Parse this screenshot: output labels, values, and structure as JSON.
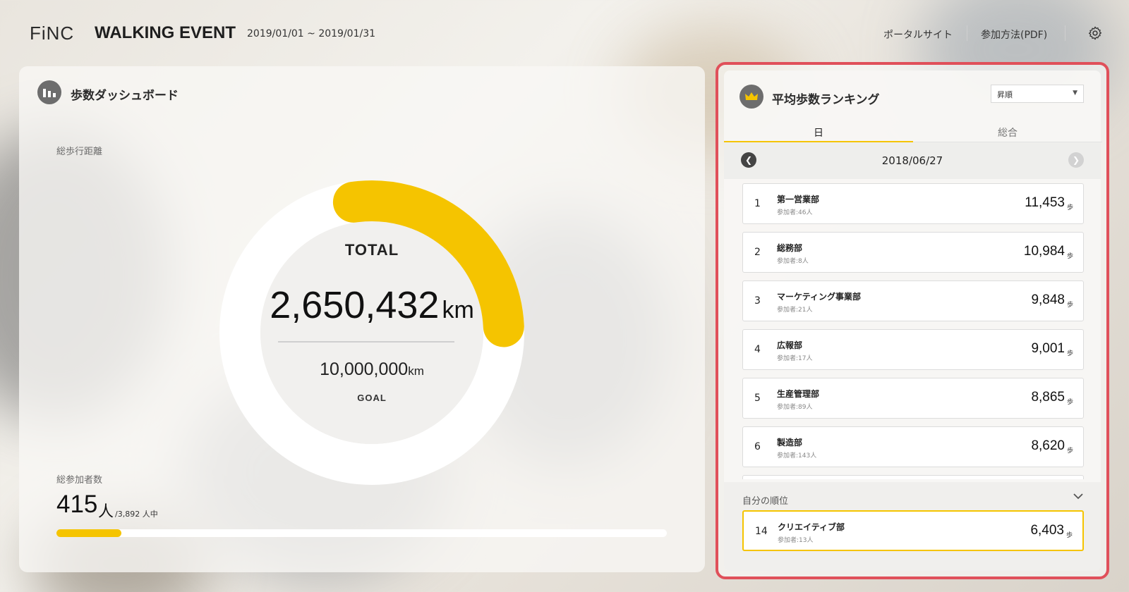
{
  "header": {
    "logo": "FiNC",
    "title": "WALKING EVENT",
    "dates": "2019/01/01 ~ 2019/01/31",
    "nav_portal": "ポータルサイト",
    "nav_pdf": "参加方法(PDF)"
  },
  "dashboard": {
    "title": "歩数ダッシュボード",
    "distance_label": "総歩行距離",
    "total_label": "TOTAL",
    "total_value": "2,650,432",
    "total_unit": "km",
    "goal_value": "10,000,000",
    "goal_unit": "km",
    "goal_label": "GOAL",
    "participants_label": "総参加者数",
    "participants_count": "415",
    "participants_unit": "人",
    "participants_total": "/3,892 人中",
    "participation_ratio": 0.1066
  },
  "ranking": {
    "title": "平均歩数ランキング",
    "sort_value": "昇順",
    "tab_day": "日",
    "tab_total": "総合",
    "date": "2018/06/27",
    "step_unit": "歩",
    "rows": [
      {
        "rank": "1",
        "name": "第一営業部",
        "members": "参加者:46人",
        "steps": "11,453"
      },
      {
        "rank": "2",
        "name": "総務部",
        "members": "参加者:8人",
        "steps": "10,984"
      },
      {
        "rank": "3",
        "name": "マーケティング事業部",
        "members": "参加者:21人",
        "steps": "9,848"
      },
      {
        "rank": "4",
        "name": "広報部",
        "members": "参加者:17人",
        "steps": "9,001"
      },
      {
        "rank": "5",
        "name": "生産管理部",
        "members": "参加者:89人",
        "steps": "8,865"
      },
      {
        "rank": "6",
        "name": "製造部",
        "members": "参加者:143人",
        "steps": "8,620"
      }
    ],
    "my_rank_label": "自分の順位",
    "my_rank": {
      "rank": "14",
      "name": "クリエイティブ部",
      "members": "参加者:13人",
      "steps": "6,403"
    }
  },
  "colors": {
    "accent": "#f5c400",
    "highlight_border": "#e0505a"
  },
  "icons": {
    "dashboard": "bar-chart-icon",
    "ranking": "crown-icon",
    "settings": "gear-icon"
  }
}
